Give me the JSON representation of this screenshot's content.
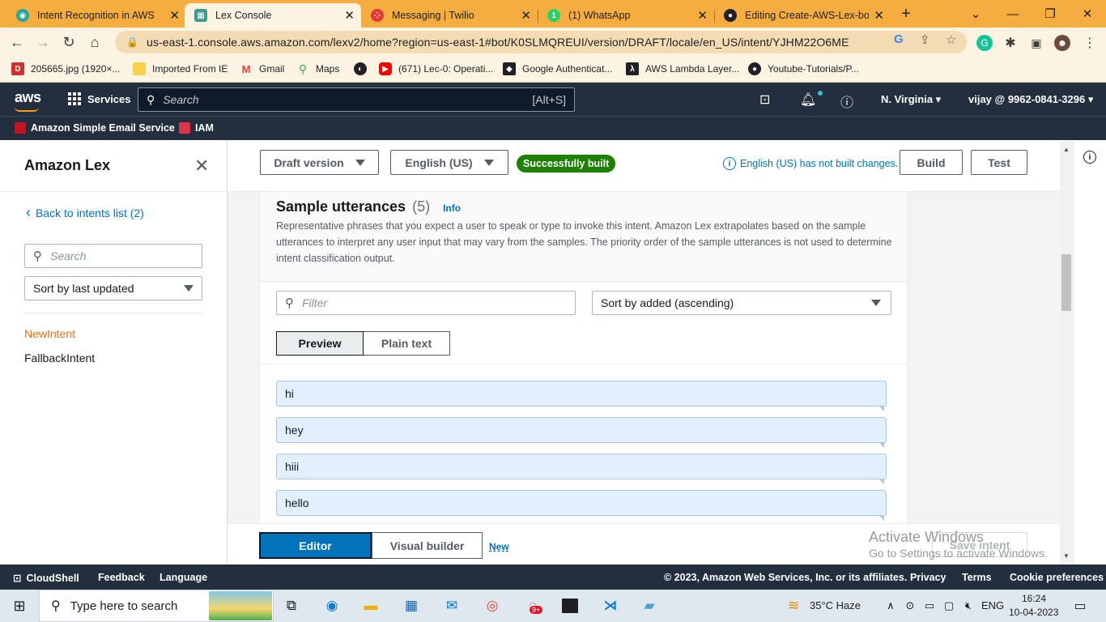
{
  "browser": {
    "tabs": [
      {
        "title": "Intent Recognition in AWS",
        "color": "#26a69a"
      },
      {
        "title": "Lex Console",
        "color": "#3d9b8f"
      },
      {
        "title": "Messaging | Twilio",
        "color": "#e53935"
      },
      {
        "title": "(1) WhatsApp",
        "color": "#25d366",
        "badge": "1"
      },
      {
        "title": "Editing Create-AWS-Lex-bot",
        "color": "#202124"
      }
    ],
    "url": "us-east-1.console.aws.amazon.com/lexv2/home?region=us-east-1#bot/K0SLMQREUI/version/DRAFT/locale/en_US/intent/YJHM22O6ME",
    "bookmarks": [
      {
        "label": "205665.jpg (1920×...",
        "icon": "D"
      },
      {
        "label": "Imported From IE",
        "icon": "folder"
      },
      {
        "label": "Gmail",
        "icon": "M"
      },
      {
        "label": "Maps",
        "icon": "pin"
      },
      {
        "label": "",
        "icon": "globe"
      },
      {
        "label": "(671) Lec-0: Operati...",
        "icon": "youtube"
      },
      {
        "label": "Google Authenticat...",
        "icon": "auth"
      },
      {
        "label": "AWS Lambda Layer...",
        "icon": "lambda"
      },
      {
        "label": "Youtube-Tutorials/P...",
        "icon": "github"
      }
    ]
  },
  "aws": {
    "services_label": "Services",
    "search_placeholder": "Search",
    "search_shortcut": "[Alt+S]",
    "region": "N. Virginia",
    "account": "vijay @ 9962-0841-3296",
    "favorites": [
      "Amazon Simple Email Service",
      "IAM"
    ]
  },
  "sidebar": {
    "title": "Amazon Lex",
    "back_link": "Back to intents list (2)",
    "search_placeholder": "Search",
    "sort_value": "Sort by last updated",
    "intents": [
      "NewIntent",
      "FallbackIntent"
    ]
  },
  "topbar": {
    "version": "Draft version",
    "language": "English (US)",
    "status": "Successfully built",
    "notice": "English (US) has not built changes.",
    "build_label": "Build",
    "test_label": "Test"
  },
  "utterances": {
    "title": "Sample utterances",
    "count": "(5)",
    "info": "Info",
    "description": "Representative phrases that you expect a user to speak or type to invoke this intent. Amazon Lex extrapolates based on the sample utterances to interpret any user input that may vary from the samples. The priority order of the sample utterances is not used to determine intent classification output.",
    "filter_placeholder": "Filter",
    "sort_value": "Sort by added (ascending)",
    "view_tabs": [
      "Preview",
      "Plain text"
    ],
    "items": [
      "hi",
      "hey",
      "hiii",
      "hello"
    ]
  },
  "bottom": {
    "editor": "Editor",
    "visual_builder": "Visual builder",
    "new": "New",
    "save": "Save intent",
    "watermark_title": "Activate Windows",
    "watermark_sub": "Go to Settings to activate Windows."
  },
  "footer": {
    "cloudshell": "CloudShell",
    "feedback": "Feedback",
    "language": "Language",
    "copyright": "© 2023, Amazon Web Services, Inc. or its affiliates.",
    "privacy": "Privacy",
    "terms": "Terms",
    "cookies": "Cookie preferences"
  },
  "taskbar": {
    "search_placeholder": "Type here to search",
    "weather": "35°C  Haze",
    "lang": "ENG",
    "time": "16:24",
    "date": "10-04-2023",
    "mail_badge": "9+"
  }
}
